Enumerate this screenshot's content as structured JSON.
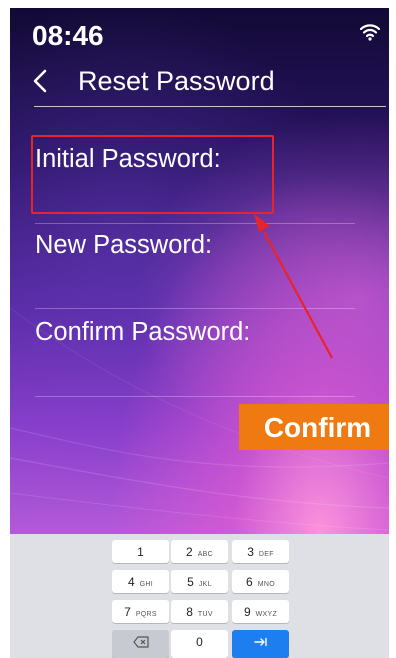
{
  "status_bar": {
    "time": "08:46",
    "wifi_icon": "wifi-icon"
  },
  "header": {
    "back_icon": "chevron-left-icon",
    "title": "Reset Password"
  },
  "form": {
    "fields": [
      {
        "label": "Initial Password:",
        "value": ""
      },
      {
        "label": "New Password:",
        "value": ""
      },
      {
        "label": "Confirm Password:",
        "value": ""
      }
    ],
    "confirm_label": "Confirm"
  },
  "annotation": {
    "highlight_color": "#e8232a"
  },
  "keypad": {
    "rows": [
      [
        {
          "digit": "1",
          "letters": ""
        },
        {
          "digit": "2",
          "letters": "ABC"
        },
        {
          "digit": "3",
          "letters": "DEF"
        }
      ],
      [
        {
          "digit": "4",
          "letters": "GHI"
        },
        {
          "digit": "5",
          "letters": "JKL"
        },
        {
          "digit": "6",
          "letters": "MNO"
        }
      ],
      [
        {
          "digit": "7",
          "letters": "PQRS"
        },
        {
          "digit": "8",
          "letters": "TUV"
        },
        {
          "digit": "9",
          "letters": "WXYZ"
        }
      ]
    ],
    "bottom_row": {
      "delete_icon": "backspace-icon",
      "zero": "0",
      "enter_icon": "tab-arrow-icon"
    }
  },
  "colors": {
    "accent": "#f07a12",
    "enter_key": "#1d7ef0"
  }
}
